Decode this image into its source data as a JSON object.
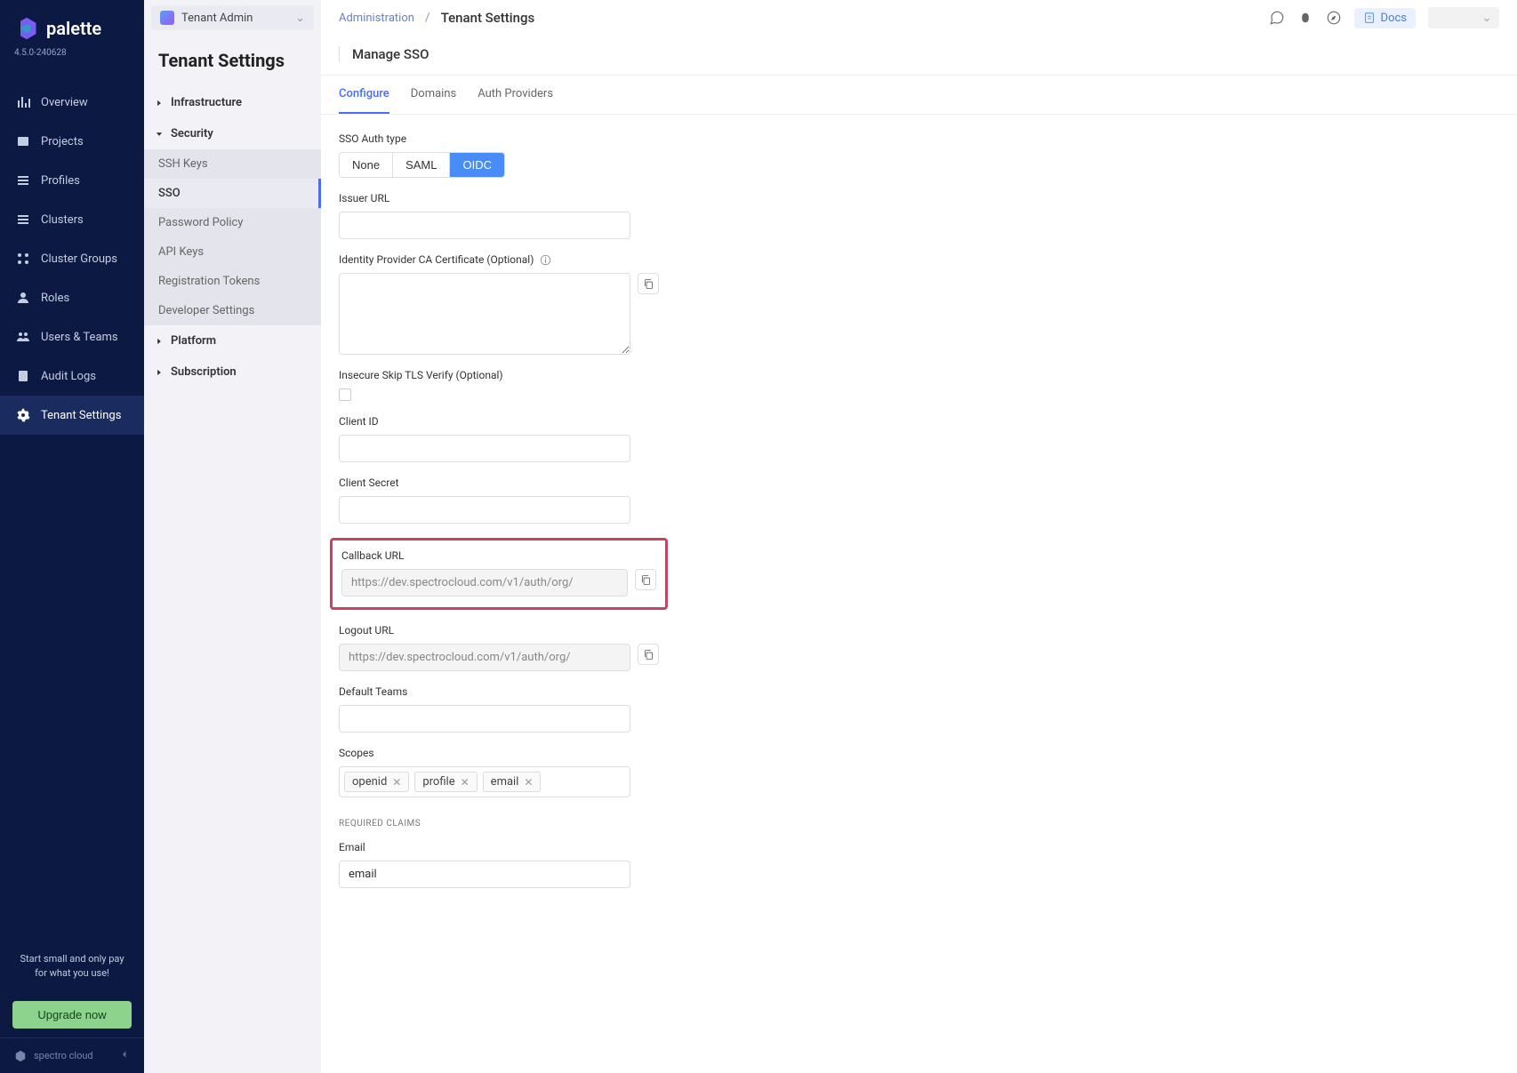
{
  "brand": {
    "name": "palette",
    "version": "4.5.0-240628",
    "footer": "spectro cloud"
  },
  "promo": {
    "line1": "Start small and only pay",
    "line2": "for what you use!",
    "cta": "Upgrade now"
  },
  "nav": {
    "items": [
      {
        "label": "Overview"
      },
      {
        "label": "Projects"
      },
      {
        "label": "Profiles"
      },
      {
        "label": "Clusters"
      },
      {
        "label": "Cluster Groups"
      },
      {
        "label": "Roles"
      },
      {
        "label": "Users & Teams"
      },
      {
        "label": "Audit Logs"
      },
      {
        "label": "Tenant Settings"
      }
    ]
  },
  "tenantSelector": {
    "label": "Tenant Admin"
  },
  "settingsSidebar": {
    "title": "Tenant Settings",
    "groups": {
      "infrastructure": "Infrastructure",
      "security": "Security",
      "platform": "Platform",
      "subscription": "Subscription"
    },
    "security_items": [
      "SSH Keys",
      "SSO",
      "Password Policy",
      "API Keys",
      "Registration Tokens",
      "Developer Settings"
    ]
  },
  "breadcrumb": {
    "root": "Administration",
    "current": "Tenant Settings"
  },
  "header_actions": {
    "docs": "Docs"
  },
  "page": {
    "subtitle": "Manage SSO"
  },
  "tabs": [
    "Configure",
    "Domains",
    "Auth Providers"
  ],
  "form": {
    "authTypeLabel": "SSO Auth type",
    "authTypes": [
      "None",
      "SAML",
      "OIDC"
    ],
    "issuerUrlLabel": "Issuer URL",
    "caCertLabel": "Identity Provider CA Certificate (Optional)",
    "insecureSkipLabel": "Insecure Skip TLS Verify (Optional)",
    "clientIdLabel": "Client ID",
    "clientSecretLabel": "Client Secret",
    "callbackUrlLabel": "Callback URL",
    "callbackUrlValue": "https://dev.spectrocloud.com/v1/auth/org/",
    "logoutUrlLabel": "Logout URL",
    "logoutUrlValue": "https://dev.spectrocloud.com/v1/auth/org/",
    "defaultTeamsLabel": "Default Teams",
    "scopesLabel": "Scopes",
    "scopes": [
      "openid",
      "profile",
      "email"
    ],
    "requiredClaimsLabel": "REQUIRED CLAIMS",
    "emailLabel": "Email",
    "emailValue": "email"
  }
}
